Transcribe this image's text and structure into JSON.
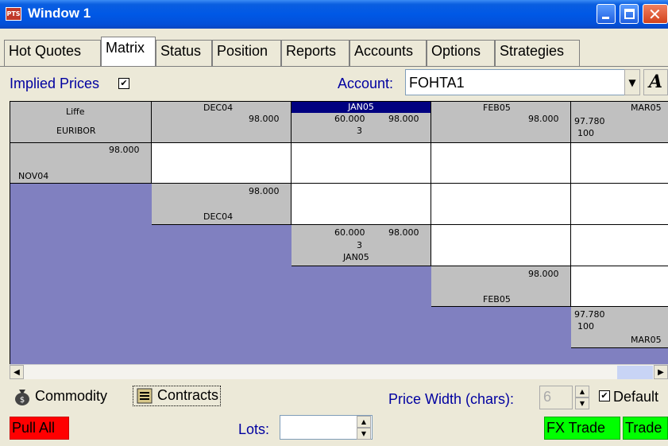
{
  "window": {
    "title": "Window 1",
    "app_icon_text": "PTS"
  },
  "tabs": [
    {
      "label": "Hot Quotes"
    },
    {
      "label": "Matrix"
    },
    {
      "label": "Status"
    },
    {
      "label": "Position"
    },
    {
      "label": "Reports"
    },
    {
      "label": "Accounts"
    },
    {
      "label": "Options"
    },
    {
      "label": "Strategies"
    }
  ],
  "active_tab": "Matrix",
  "toolbar": {
    "implied_prices_label": "Implied Prices",
    "implied_prices_checked": true,
    "account_label": "Account:",
    "account_value": "FOHTA1",
    "font_button": "A"
  },
  "matrix": {
    "corner": {
      "exchange": "Liffe",
      "product": "EURIBOR"
    },
    "columns": [
      {
        "name": "DEC04",
        "bid": "",
        "ask": "98.000",
        "qty": ""
      },
      {
        "name": "JAN05",
        "bid": "60.000",
        "ask": "98.000",
        "qty": "3",
        "selected": true
      },
      {
        "name": "FEB05",
        "bid": "",
        "ask": "98.000",
        "qty": ""
      },
      {
        "name": "MAR05",
        "bid": "97.780",
        "ask": "",
        "qty": "100"
      }
    ],
    "rows": [
      {
        "name": "NOV04",
        "bid": "",
        "ask": "98.000",
        "qty": ""
      },
      {
        "name": "DEC04",
        "bid": "",
        "ask": "98.000",
        "qty": ""
      },
      {
        "name": "JAN05",
        "bid": "60.000",
        "ask": "98.000",
        "qty": "3"
      },
      {
        "name": "FEB05",
        "bid": "",
        "ask": "98.000",
        "qty": ""
      },
      {
        "name": "MAR05",
        "bid": "97.780",
        "ask": "",
        "qty": "100"
      }
    ]
  },
  "bottom": {
    "commodity_label": "Commodity",
    "contracts_label": "Contracts",
    "price_width_label": "Price Width (chars):",
    "price_width_value": "6",
    "default_label": "Default",
    "default_checked": true,
    "pull_all_label": "Pull All",
    "lots_label": "Lots:",
    "lots_value": "",
    "fx_trade_label": "FX Trade",
    "trade_label": "Trade"
  },
  "colors": {
    "matrix_background": "#8080c0",
    "header_gray": "#c0c0c0",
    "selected_header": "#000080",
    "pull_all": "#ff0000",
    "trade": "#00ff00",
    "label_blue": "#0000a0"
  }
}
